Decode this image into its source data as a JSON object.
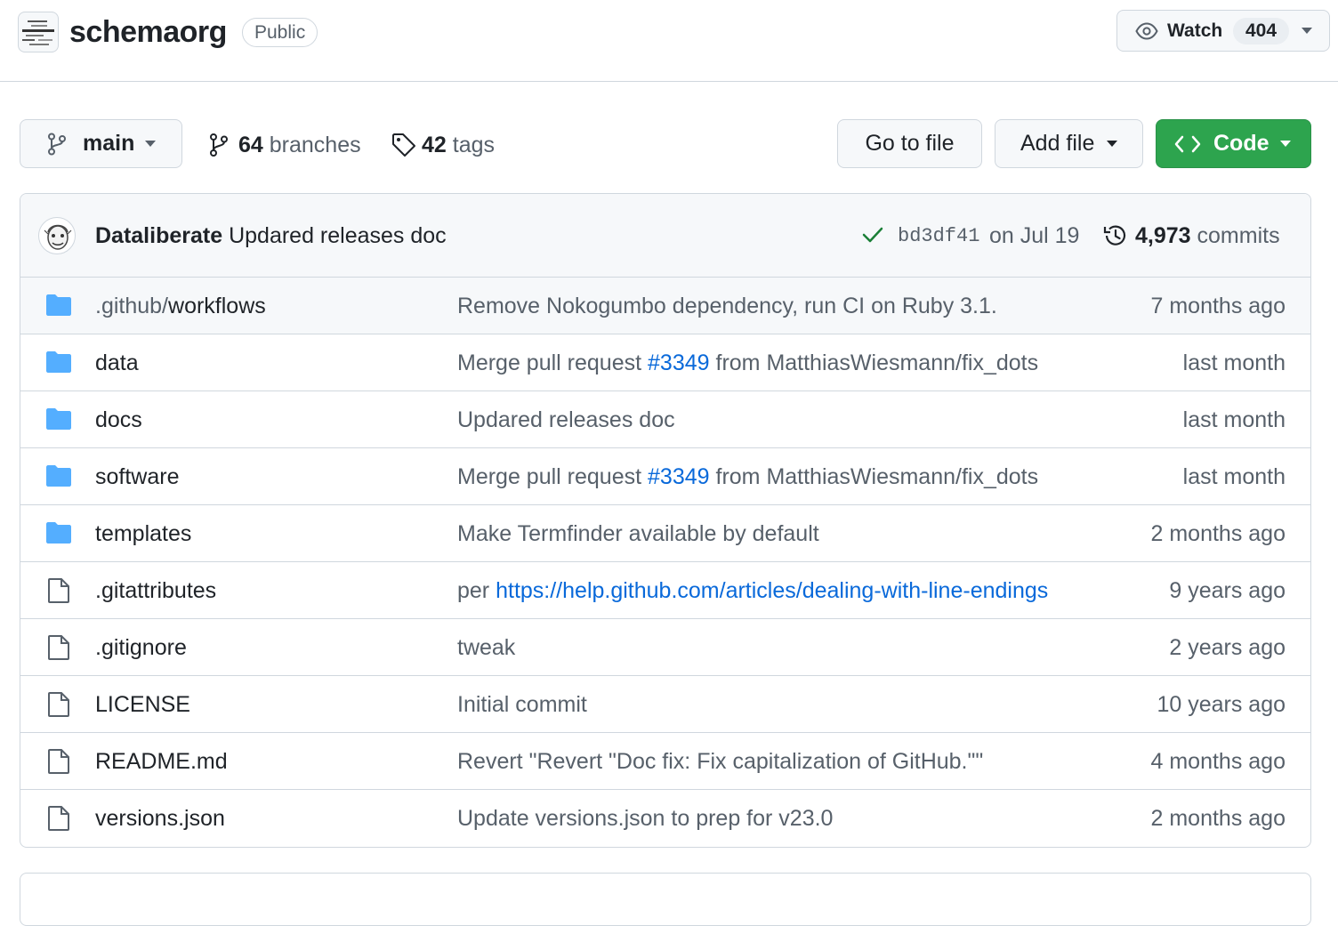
{
  "repo": {
    "name": "schemaorg",
    "visibility": "Public"
  },
  "watch": {
    "label": "Watch",
    "count": "404"
  },
  "toolbar": {
    "branch": "main",
    "branches_count": "64",
    "branches_label": "branches",
    "tags_count": "42",
    "tags_label": "tags",
    "goto_label": "Go to file",
    "addfile_label": "Add file",
    "code_label": "Code"
  },
  "colors": {
    "accent_green": "#2da44e",
    "link_blue": "#0969da",
    "folder_blue": "#54aeff",
    "muted_text": "#57606a"
  },
  "commit": {
    "author": "Dataliberate",
    "message": "Updared releases doc",
    "sha": "bd3df41",
    "date": "on Jul 19",
    "count": "4,973",
    "count_label": "commits"
  },
  "files": [
    {
      "type": "folder",
      "prefix": ".github/",
      "name": "workflows",
      "msg_pre": "Remove Nokogumbo dependency, run CI on Ruby 3.1.",
      "msg_link": "",
      "msg_post": "",
      "time": "7 months ago"
    },
    {
      "type": "folder",
      "prefix": "",
      "name": "data",
      "msg_pre": "Merge pull request ",
      "msg_link": "#3349",
      "msg_post": " from MatthiasWiesmann/fix_dots",
      "time": "last month"
    },
    {
      "type": "folder",
      "prefix": "",
      "name": "docs",
      "msg_pre": "Updared releases doc",
      "msg_link": "",
      "msg_post": "",
      "time": "last month"
    },
    {
      "type": "folder",
      "prefix": "",
      "name": "software",
      "msg_pre": "Merge pull request ",
      "msg_link": "#3349",
      "msg_post": " from MatthiasWiesmann/fix_dots",
      "time": "last month"
    },
    {
      "type": "folder",
      "prefix": "",
      "name": "templates",
      "msg_pre": "Make Termfinder available by default",
      "msg_link": "",
      "msg_post": "",
      "time": "2 months ago"
    },
    {
      "type": "file",
      "prefix": "",
      "name": ".gitattributes",
      "msg_pre": "per ",
      "msg_link": "https://help.github.com/articles/dealing-with-line-endings",
      "msg_post": "",
      "time": "9 years ago"
    },
    {
      "type": "file",
      "prefix": "",
      "name": ".gitignore",
      "msg_pre": "tweak",
      "msg_link": "",
      "msg_post": "",
      "time": "2 years ago"
    },
    {
      "type": "file",
      "prefix": "",
      "name": "LICENSE",
      "msg_pre": "Initial commit",
      "msg_link": "",
      "msg_post": "",
      "time": "10 years ago"
    },
    {
      "type": "file",
      "prefix": "",
      "name": "README.md",
      "msg_pre": "Revert \"Revert \"Doc fix: Fix capitalization of GitHub.\"\"",
      "msg_link": "",
      "msg_post": "",
      "time": "4 months ago"
    },
    {
      "type": "file",
      "prefix": "",
      "name": "versions.json",
      "msg_pre": "Update versions.json to prep for v23.0",
      "msg_link": "",
      "msg_post": "",
      "time": "2 months ago"
    }
  ]
}
